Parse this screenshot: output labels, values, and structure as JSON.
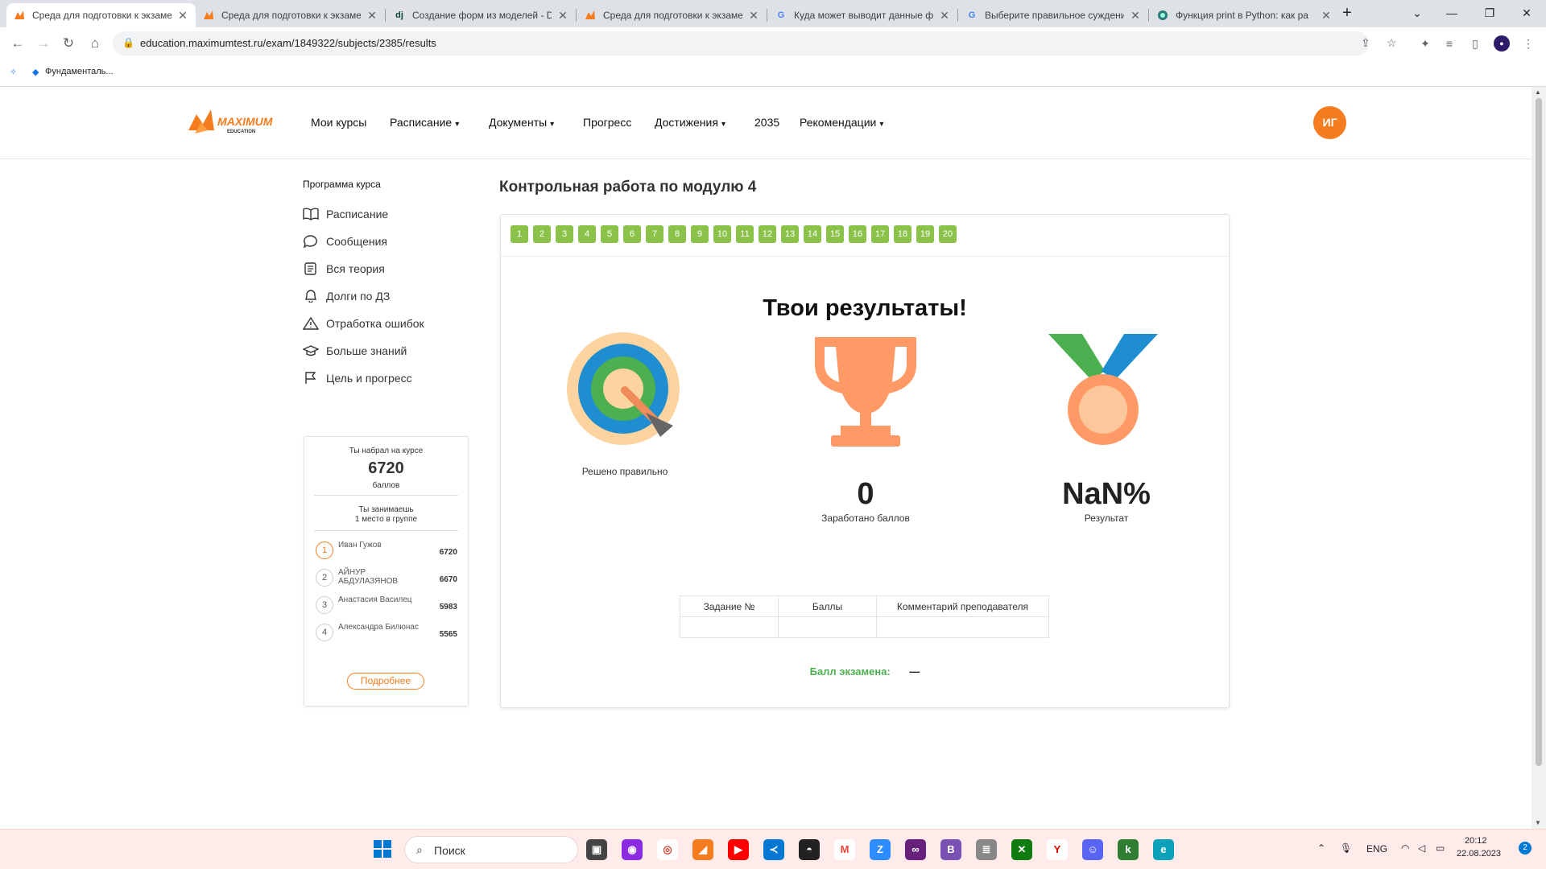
{
  "browser": {
    "tabs": [
      {
        "title": "Среда для подготовки к экзаме",
        "icon": "maximum-icon"
      },
      {
        "title": "Среда для подготовки к экзаме",
        "icon": "maximum-icon"
      },
      {
        "title": "Создание форм из моделей - D",
        "icon": "django-icon"
      },
      {
        "title": "Среда для подготовки к экзаме",
        "icon": "maximum-icon"
      },
      {
        "title": "Куда может выводит данные ф",
        "icon": "google-icon"
      },
      {
        "title": "Выберите правильное суждени",
        "icon": "google-icon"
      },
      {
        "title": "Функция print в Python: как ра",
        "icon": "globe-icon"
      }
    ],
    "new_tab": "+",
    "url": "education.maximumtest.ru/exam/1849322/subjects/2385/results",
    "bookmark": "Фундаменталь..."
  },
  "header": {
    "logo_text": "MAXIMUM",
    "logo_sub": "EDUCATION",
    "nav": [
      {
        "label": "Мои курсы",
        "dropdown": false
      },
      {
        "label": "Расписание",
        "dropdown": true
      },
      {
        "label": "Документы",
        "dropdown": true
      },
      {
        "label": "Прогресс",
        "dropdown": false
      },
      {
        "label": "Достижения",
        "dropdown": true
      },
      {
        "label": "2035",
        "dropdown": false
      },
      {
        "label": "Рекомендации",
        "dropdown": true
      }
    ],
    "avatar": "ИГ",
    "accent": "#f57c1f"
  },
  "sidebar": {
    "title": "Программа курса",
    "items": [
      {
        "label": "Расписание",
        "icon": "book-icon"
      },
      {
        "label": "Сообщения",
        "icon": "chat-icon"
      },
      {
        "label": "Вся теория",
        "icon": "notes-icon"
      },
      {
        "label": "Долги по ДЗ",
        "icon": "bell-icon"
      },
      {
        "label": "Отработка ошибок",
        "icon": "warning-icon"
      },
      {
        "label": "Больше знаний",
        "icon": "graduation-cap-icon"
      },
      {
        "label": "Цель и прогресс",
        "icon": "flag-icon"
      }
    ],
    "rank": {
      "score_caption": "Ты набрал на курсе",
      "score": "6720",
      "score_unit": "баллов",
      "place_line1": "Ты занимаешь",
      "place_line2": "1 место в группе",
      "rows": [
        {
          "place": "1",
          "name": "Иван Гужов",
          "score": "6720"
        },
        {
          "place": "2",
          "name": "АЙНУР АБДУЛАЗЯНОВ",
          "score": "6670"
        },
        {
          "place": "3",
          "name": "Анастасия Василец",
          "score": "5983"
        },
        {
          "place": "4",
          "name": "Александра Билюнас",
          "score": "5565"
        }
      ],
      "more": "Подробнее"
    }
  },
  "main": {
    "title": "Контрольная работа по модулю 4",
    "questions": [
      "1",
      "2",
      "3",
      "4",
      "5",
      "6",
      "7",
      "8",
      "9",
      "10",
      "11",
      "12",
      "13",
      "14",
      "15",
      "16",
      "17",
      "18",
      "19",
      "20"
    ],
    "question_color": "#8bc34a",
    "results_title": "Твои результаты!",
    "solved_label": "Решено правильно",
    "points_value": "0",
    "points_label": "Заработано баллов",
    "percent_value": "NaN%",
    "percent_label": "Результат",
    "table_headers": [
      "Задание №",
      "Баллы",
      "Комментарий преподавателя"
    ],
    "exam_label": "Балл экзамена:",
    "exam_value": "—"
  },
  "taskbar": {
    "search": "Поиск",
    "lang": "ENG",
    "time": "20:12",
    "date": "22.08.2023",
    "notifications": "2"
  }
}
